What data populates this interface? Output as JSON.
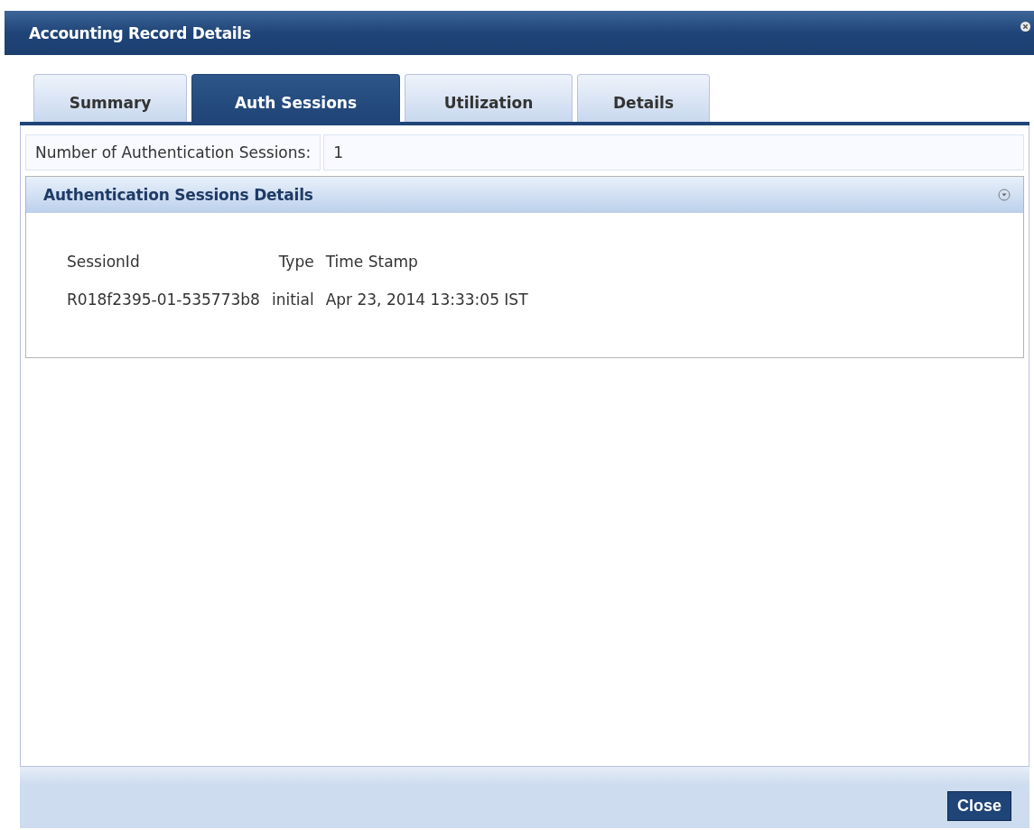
{
  "window": {
    "title": "Accounting Record Details"
  },
  "tabs": [
    {
      "label": "Summary",
      "selected": false
    },
    {
      "label": "Auth Sessions",
      "selected": true
    },
    {
      "label": "Utilization",
      "selected": false
    },
    {
      "label": "Details",
      "selected": false
    }
  ],
  "count": {
    "label": "Number of Authentication Sessions:",
    "value": "1"
  },
  "section": {
    "title": "Authentication Sessions Details",
    "expanded": true,
    "table": {
      "columns": [
        "SessionId",
        "Type",
        "Time Stamp"
      ],
      "rows": [
        [
          "R018f2395-01-535773b8",
          "initial",
          "Apr 23, 2014 13:33:05 IST"
        ]
      ]
    }
  },
  "buttons": [
    "Close"
  ]
}
